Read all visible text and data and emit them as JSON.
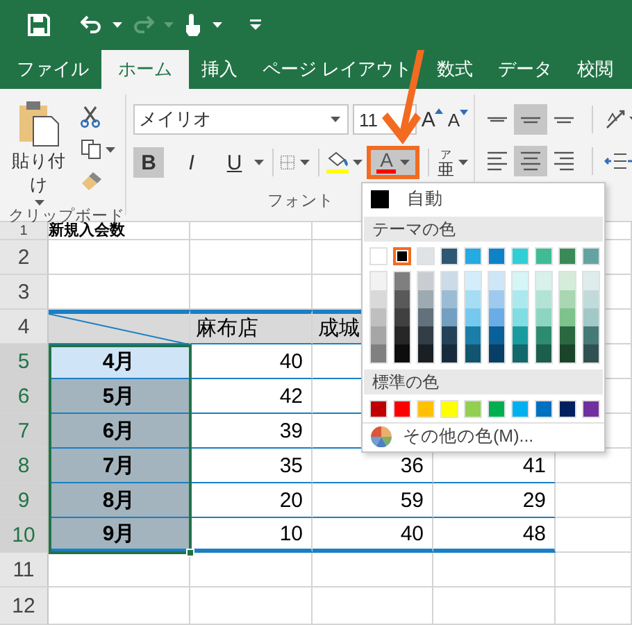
{
  "quick_access": [
    {
      "kind": "save",
      "disabled": false
    },
    {
      "kind": "undo",
      "disabled": false
    },
    {
      "kind": "redo",
      "disabled": true
    },
    {
      "kind": "touch",
      "disabled": false
    }
  ],
  "tabs": [
    {
      "label": "ファイル",
      "selected": false
    },
    {
      "label": "ホーム",
      "selected": true
    },
    {
      "label": "挿入",
      "selected": false
    },
    {
      "label": "ページ レイアウト",
      "selected": false
    },
    {
      "label": "数式",
      "selected": false
    },
    {
      "label": "データ",
      "selected": false
    },
    {
      "label": "校閲",
      "selected": false
    }
  ],
  "ribbon": {
    "clipboard": {
      "paste_label": "貼り付け",
      "group_label": "クリップボード"
    },
    "font": {
      "font_name": "メイリオ",
      "font_size": "11",
      "grow_label": "A",
      "shrink_label": "A",
      "buttons": [
        {
          "kind": "bold",
          "label": "B",
          "on": true
        },
        {
          "kind": "italic",
          "label": "I",
          "on": false
        },
        {
          "kind": "underline",
          "label": "U",
          "on": false
        }
      ],
      "fill_color_button": {
        "color": "#ffff00"
      },
      "font_color_button": {
        "label": "A",
        "color": "#ff0000",
        "highlighted": true
      },
      "phonetic": {
        "label": "亜",
        "ruby": "ア"
      },
      "group_label": "フォント"
    },
    "alignment": {
      "buttons": [
        {
          "kind": "align-top",
          "on": false
        },
        {
          "kind": "align-middle",
          "on": true
        },
        {
          "kind": "align-bottom",
          "on": false
        },
        {
          "kind": "align-left",
          "on": false
        },
        {
          "kind": "align-center",
          "on": true
        },
        {
          "kind": "align-right",
          "on": false
        }
      ]
    }
  },
  "sheet": {
    "title": "新規入会数",
    "row_headers": [
      {
        "label": "1",
        "selected": false
      },
      {
        "label": "2",
        "selected": false
      },
      {
        "label": "3",
        "selected": false
      },
      {
        "label": "4",
        "selected": false
      },
      {
        "label": "5",
        "selected": true
      },
      {
        "label": "6",
        "selected": true
      },
      {
        "label": "7",
        "selected": true
      },
      {
        "label": "8",
        "selected": true
      },
      {
        "label": "9",
        "selected": true
      },
      {
        "label": "10",
        "selected": true
      },
      {
        "label": "11",
        "selected": false
      },
      {
        "label": "12",
        "selected": false
      }
    ],
    "table": {
      "columns": [
        "麻布店",
        "成城"
      ],
      "rows": [
        {
          "month": "4月",
          "selected": true,
          "active": true,
          "values": [
            "40"
          ]
        },
        {
          "month": "5月",
          "selected": true,
          "active": false,
          "values": [
            "42"
          ]
        },
        {
          "month": "6月",
          "selected": true,
          "active": false,
          "values": [
            "39"
          ]
        },
        {
          "month": "7月",
          "selected": true,
          "active": false,
          "values": [
            "35",
            "36",
            "41"
          ]
        },
        {
          "month": "8月",
          "selected": true,
          "active": false,
          "values": [
            "20",
            "59",
            "29"
          ]
        },
        {
          "month": "9月",
          "selected": true,
          "active": false,
          "values": [
            "10",
            "40",
            "48"
          ]
        }
      ]
    }
  },
  "color_menu": {
    "automatic": {
      "label": "自動",
      "color": "#000000"
    },
    "theme_heading": "テーマの色",
    "theme_colors": [
      {
        "color": "#ffffff",
        "selected": false
      },
      {
        "color": "#000000",
        "selected": true
      },
      {
        "color": "#e0e3e6",
        "selected": false
      },
      {
        "color": "#2f5672",
        "selected": false
      },
      {
        "color": "#25aae2",
        "selected": false
      },
      {
        "color": "#0d82c8",
        "selected": false
      },
      {
        "color": "#2fcfd6",
        "selected": false
      },
      {
        "color": "#3fbb96",
        "selected": false
      },
      {
        "color": "#3a8a58",
        "selected": false
      },
      {
        "color": "#63a4a3",
        "selected": false
      }
    ],
    "shade_columns": [
      {
        "shades": [
          {
            "color": "#f2f2f2"
          },
          {
            "color": "#d9d9d9"
          },
          {
            "color": "#bfbfbf"
          },
          {
            "color": "#a6a6a6"
          },
          {
            "color": "#808080"
          }
        ]
      },
      {
        "shades": [
          {
            "color": "#7f7f7f"
          },
          {
            "color": "#595959"
          },
          {
            "color": "#404040"
          },
          {
            "color": "#262626"
          },
          {
            "color": "#0d0d0d"
          }
        ]
      },
      {
        "shades": [
          {
            "color": "#c9cdd1"
          },
          {
            "color": "#9eaab2"
          },
          {
            "color": "#62717c"
          },
          {
            "color": "#323d45"
          },
          {
            "color": "#191f23"
          }
        ]
      },
      {
        "shades": [
          {
            "color": "#cbdbe7"
          },
          {
            "color": "#9bbdd4"
          },
          {
            "color": "#739fc0"
          },
          {
            "color": "#25415a"
          },
          {
            "color": "#182b3c"
          }
        ]
      },
      {
        "shades": [
          {
            "color": "#d3eefa"
          },
          {
            "color": "#a7ddf4"
          },
          {
            "color": "#76c9ee"
          },
          {
            "color": "#1a7ea9"
          },
          {
            "color": "#125570"
          }
        ]
      },
      {
        "shades": [
          {
            "color": "#cde6f8"
          },
          {
            "color": "#9ecaef"
          },
          {
            "color": "#6aade6"
          },
          {
            "color": "#0a619a"
          },
          {
            "color": "#083f66"
          }
        ]
      },
      {
        "shades": [
          {
            "color": "#d5f5f7"
          },
          {
            "color": "#ace9ee"
          },
          {
            "color": "#80dde3"
          },
          {
            "color": "#1b9ba0"
          },
          {
            "color": "#12686b"
          }
        ]
      },
      {
        "shades": [
          {
            "color": "#d8f1ea"
          },
          {
            "color": "#b2e3d5"
          },
          {
            "color": "#8ed5c1"
          },
          {
            "color": "#2d8b70"
          },
          {
            "color": "#1d5d4b"
          }
        ]
      },
      {
        "shades": [
          {
            "color": "#d6ecdb"
          },
          {
            "color": "#a9d6b3"
          },
          {
            "color": "#7ec38c"
          },
          {
            "color": "#2b6840"
          },
          {
            "color": "#1b452a"
          }
        ]
      },
      {
        "shades": [
          {
            "color": "#dfecec"
          },
          {
            "color": "#c1dada"
          },
          {
            "color": "#a3c8c8"
          },
          {
            "color": "#467a79"
          },
          {
            "color": "#2f5151"
          }
        ]
      }
    ],
    "standard_heading": "標準の色",
    "standard_colors": [
      {
        "color": "#c00000"
      },
      {
        "color": "#ff0000"
      },
      {
        "color": "#ffc000"
      },
      {
        "color": "#ffff00"
      },
      {
        "color": "#92d050"
      },
      {
        "color": "#00b050"
      },
      {
        "color": "#00b0f0"
      },
      {
        "color": "#0070c0"
      },
      {
        "color": "#002060"
      },
      {
        "color": "#7030a0"
      }
    ],
    "more_colors": "その他の色(M)..."
  }
}
